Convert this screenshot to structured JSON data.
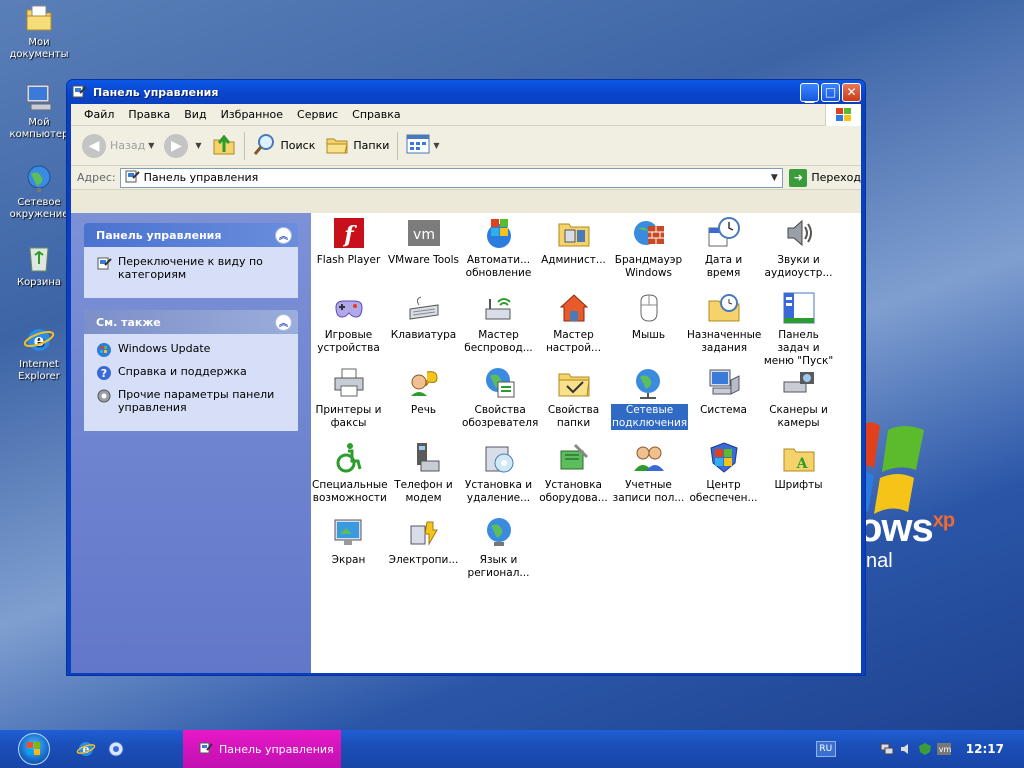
{
  "desktop": {
    "icons": [
      {
        "label": "Мои документы"
      },
      {
        "label": "Мой компьютер"
      },
      {
        "label": "Сетевое окружение"
      },
      {
        "label": "Корзина"
      },
      {
        "label": "Internet Explorer"
      }
    ],
    "wallpaper_text": "ows",
    "wallpaper_sup": "xp",
    "wallpaper_edition": "nal"
  },
  "window": {
    "title": "Панель управления",
    "menu": [
      "Файл",
      "Правка",
      "Вид",
      "Избранное",
      "Сервис",
      "Справка"
    ],
    "toolbar": {
      "back": "Назад",
      "search": "Поиск",
      "folders": "Папки"
    },
    "address": {
      "label": "Адрес:",
      "value": "Панель управления",
      "go": "Переход"
    }
  },
  "taskpane": {
    "section1": {
      "title": "Панель управления",
      "links": [
        "Переключение к виду по категориям"
      ]
    },
    "section2": {
      "title": "См. также",
      "links": [
        "Windows Update",
        "Справка и поддержка",
        "Прочие параметры панели управления"
      ]
    }
  },
  "items": [
    {
      "label": "Flash Player",
      "icon": "flash-icon"
    },
    {
      "label": "VMware Tools",
      "icon": "vmware-icon"
    },
    {
      "label": "Автомати... обновление",
      "icon": "auto-update-icon"
    },
    {
      "label": "Админист...",
      "icon": "admin-tools-icon"
    },
    {
      "label": "Брандмауэр Windows",
      "icon": "firewall-icon"
    },
    {
      "label": "Дата и время",
      "icon": "datetime-icon"
    },
    {
      "label": "Звуки и аудиоустр...",
      "icon": "sound-icon"
    },
    {
      "label": "Игровые устройства",
      "icon": "gamepad-icon"
    },
    {
      "label": "Клавиатура",
      "icon": "keyboard-icon"
    },
    {
      "label": "Мастер беспровод...",
      "icon": "wireless-icon"
    },
    {
      "label": "Мастер настрой...",
      "icon": "network-setup-icon"
    },
    {
      "label": "Мышь",
      "icon": "mouse-icon"
    },
    {
      "label": "Назначенные задания",
      "icon": "scheduled-tasks-icon"
    },
    {
      "label": "Панель задач и меню \"Пуск\"",
      "icon": "taskbar-icon"
    },
    {
      "label": "Принтеры и факсы",
      "icon": "printer-icon"
    },
    {
      "label": "Речь",
      "icon": "speech-icon"
    },
    {
      "label": "Свойства обозревателя",
      "icon": "internet-options-icon"
    },
    {
      "label": "Свойства папки",
      "icon": "folder-options-icon"
    },
    {
      "label": "Сетевые подключения",
      "icon": "network-connections-icon",
      "selected": true
    },
    {
      "label": "Система",
      "icon": "system-icon"
    },
    {
      "label": "Сканеры и камеры",
      "icon": "scanner-icon"
    },
    {
      "label": "Специальные возможности",
      "icon": "accessibility-icon"
    },
    {
      "label": "Телефон и модем",
      "icon": "phone-modem-icon"
    },
    {
      "label": "Установка и удаление...",
      "icon": "add-remove-icon"
    },
    {
      "label": "Установка оборудова...",
      "icon": "add-hardware-icon"
    },
    {
      "label": "Учетные записи пол...",
      "icon": "user-accounts-icon"
    },
    {
      "label": "Центр обеспечен...",
      "icon": "security-center-icon"
    },
    {
      "label": "Шрифты",
      "icon": "fonts-icon"
    },
    {
      "label": "Экран",
      "icon": "display-icon"
    },
    {
      "label": "Электропи...",
      "icon": "power-icon"
    },
    {
      "label": "Язык и регионал...",
      "icon": "regional-icon"
    }
  ],
  "taskbar": {
    "task_label": "Панель управления",
    "lang": "RU",
    "clock": "12:17"
  }
}
